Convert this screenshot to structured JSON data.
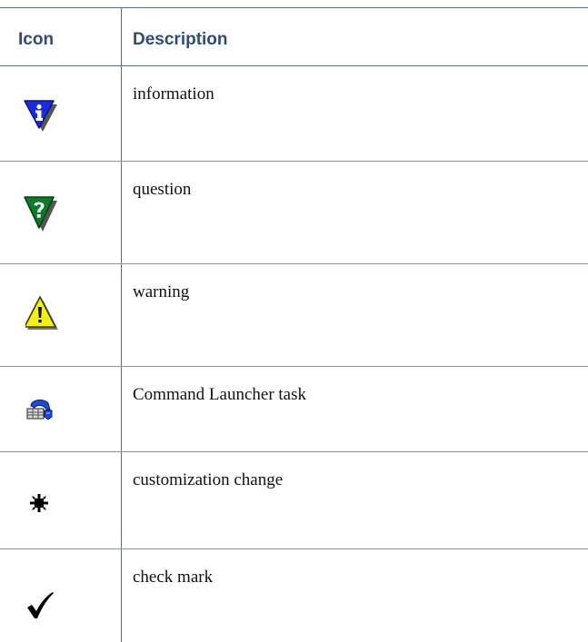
{
  "table": {
    "headers": {
      "icon": "Icon",
      "description": "Description"
    },
    "rows": [
      {
        "icon": "information-icon",
        "description": "information"
      },
      {
        "icon": "question-icon",
        "description": "question"
      },
      {
        "icon": "warning-icon",
        "description": "warning"
      },
      {
        "icon": "command-launcher-task-icon",
        "description": "Command Launcher task"
      },
      {
        "icon": "customization-change-icon",
        "description": "customization change"
      },
      {
        "icon": "check-mark-icon",
        "description": "check mark"
      }
    ]
  },
  "colors": {
    "header_text": "#2c4c7c",
    "rule": "#5a6a84",
    "info_blue": "#1a2cd8",
    "question_green": "#117a2a",
    "warning_yellow": "#f2ee1a"
  }
}
